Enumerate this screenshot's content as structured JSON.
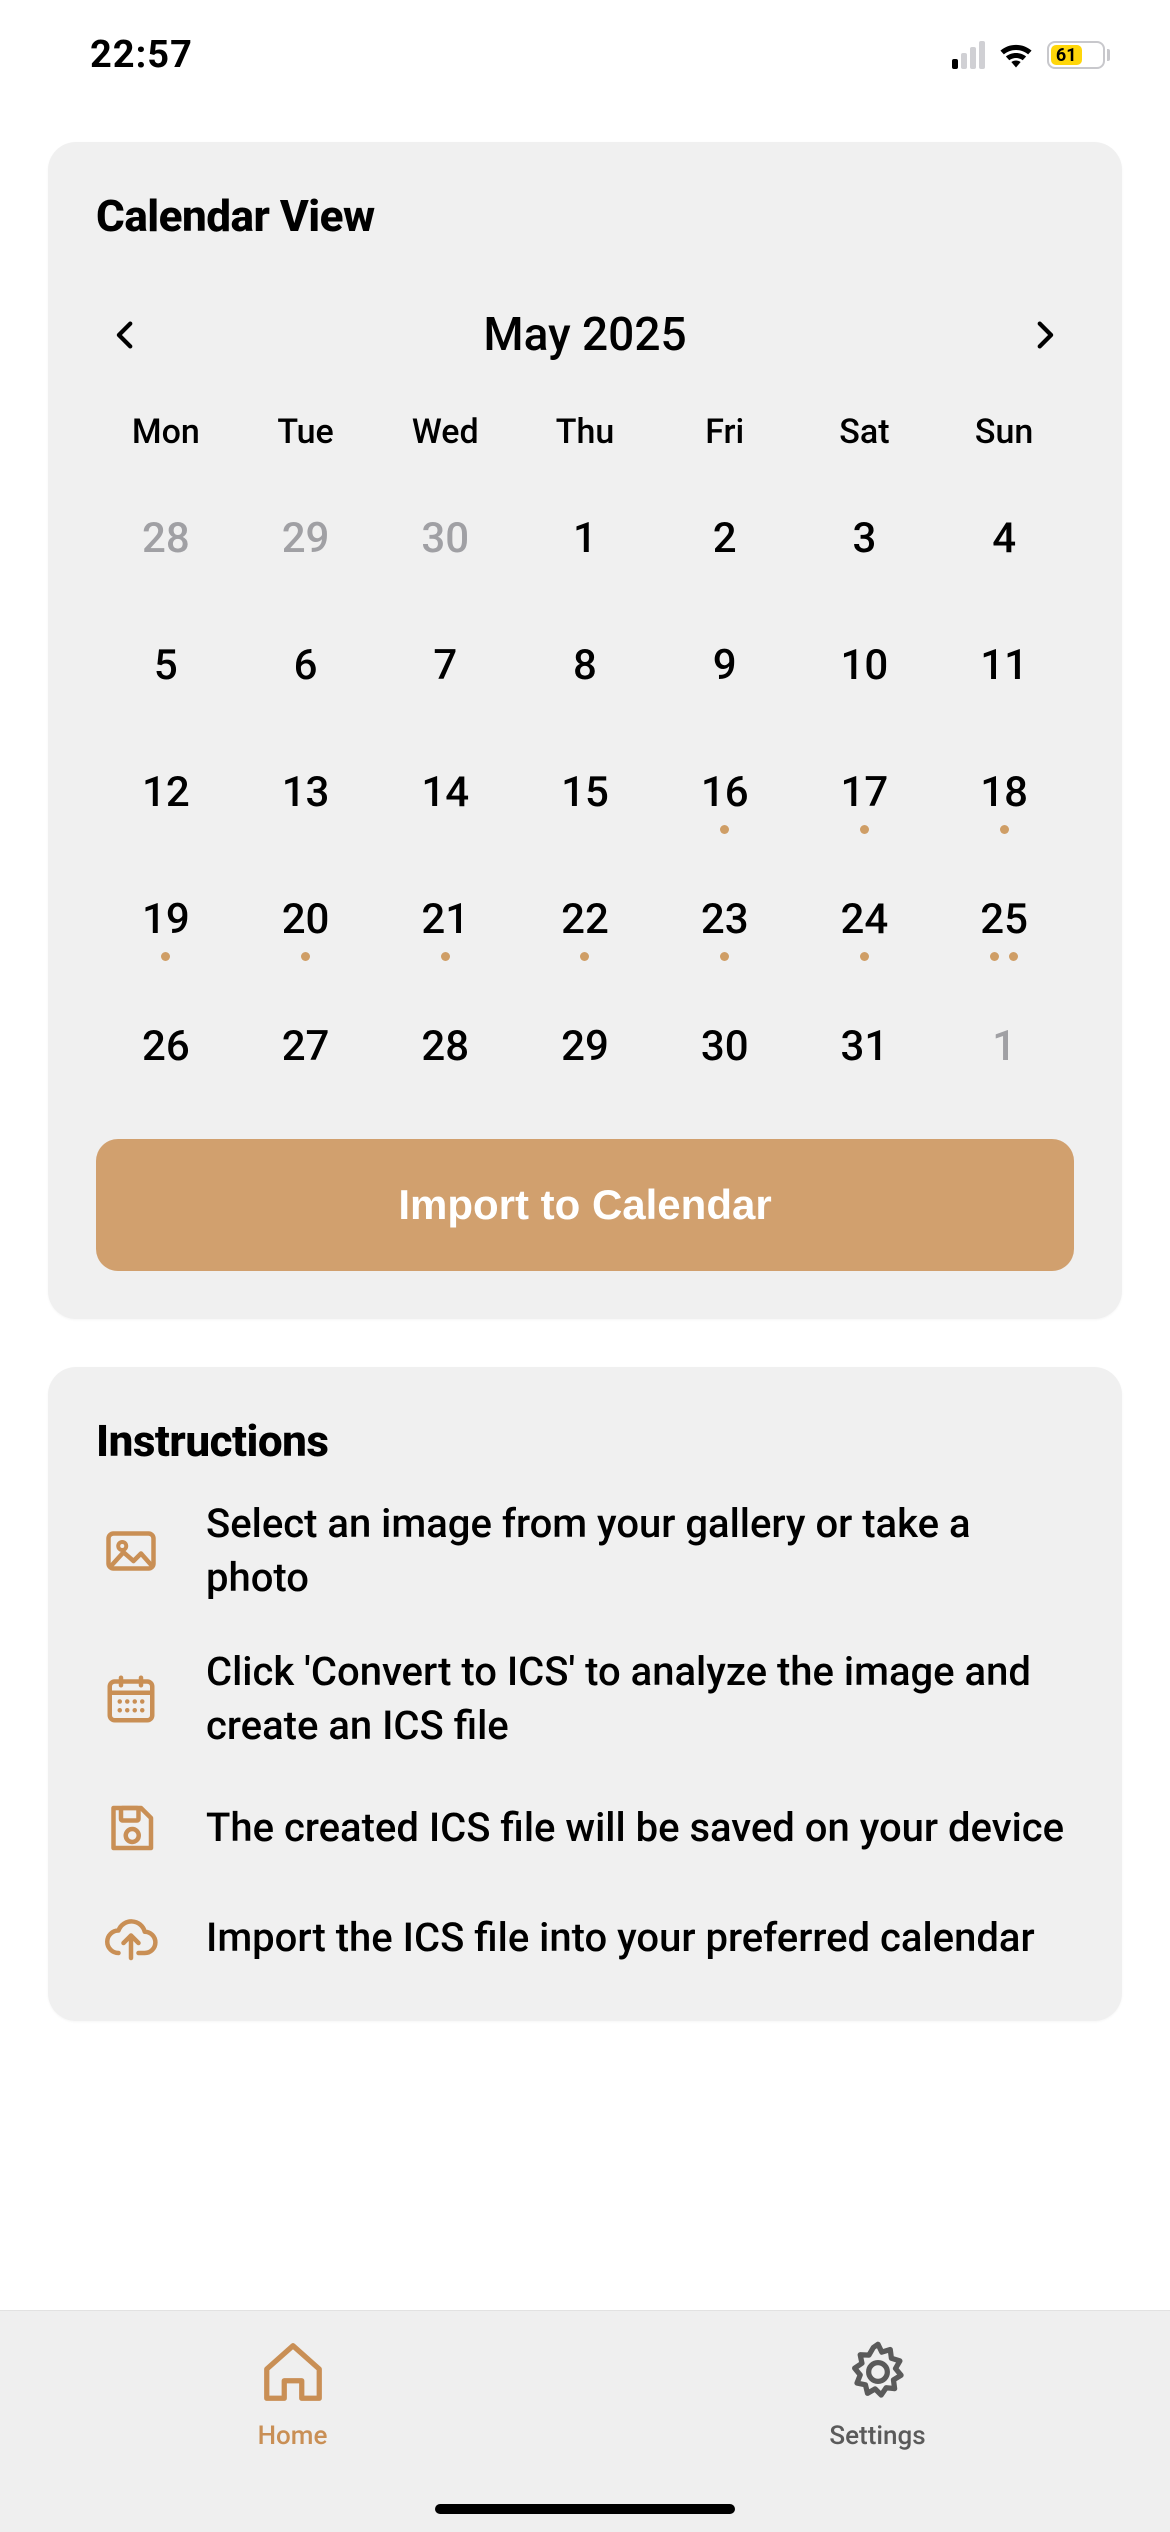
{
  "status": {
    "time": "22:57",
    "battery": "61"
  },
  "calendar_card": {
    "title": "Calendar View",
    "month_label": "May 2025",
    "weekdays": [
      "Mon",
      "Tue",
      "Wed",
      "Thu",
      "Fri",
      "Sat",
      "Sun"
    ],
    "days": [
      {
        "n": "28",
        "other": true,
        "dots": 0
      },
      {
        "n": "29",
        "other": true,
        "dots": 0
      },
      {
        "n": "30",
        "other": true,
        "dots": 0
      },
      {
        "n": "1",
        "other": false,
        "dots": 0
      },
      {
        "n": "2",
        "other": false,
        "dots": 0
      },
      {
        "n": "3",
        "other": false,
        "dots": 0
      },
      {
        "n": "4",
        "other": false,
        "dots": 0
      },
      {
        "n": "5",
        "other": false,
        "dots": 0
      },
      {
        "n": "6",
        "other": false,
        "dots": 0
      },
      {
        "n": "7",
        "other": false,
        "dots": 0
      },
      {
        "n": "8",
        "other": false,
        "dots": 0
      },
      {
        "n": "9",
        "other": false,
        "dots": 0
      },
      {
        "n": "10",
        "other": false,
        "dots": 0
      },
      {
        "n": "11",
        "other": false,
        "dots": 0
      },
      {
        "n": "12",
        "other": false,
        "dots": 0
      },
      {
        "n": "13",
        "other": false,
        "dots": 0
      },
      {
        "n": "14",
        "other": false,
        "dots": 0
      },
      {
        "n": "15",
        "other": false,
        "dots": 0
      },
      {
        "n": "16",
        "other": false,
        "dots": 1
      },
      {
        "n": "17",
        "other": false,
        "dots": 1
      },
      {
        "n": "18",
        "other": false,
        "dots": 1
      },
      {
        "n": "19",
        "other": false,
        "dots": 1
      },
      {
        "n": "20",
        "other": false,
        "dots": 1
      },
      {
        "n": "21",
        "other": false,
        "dots": 1
      },
      {
        "n": "22",
        "other": false,
        "dots": 1
      },
      {
        "n": "23",
        "other": false,
        "dots": 1
      },
      {
        "n": "24",
        "other": false,
        "dots": 1
      },
      {
        "n": "25",
        "other": false,
        "dots": 2
      },
      {
        "n": "26",
        "other": false,
        "dots": 0
      },
      {
        "n": "27",
        "other": false,
        "dots": 0
      },
      {
        "n": "28",
        "other": false,
        "dots": 0
      },
      {
        "n": "29",
        "other": false,
        "dots": 0
      },
      {
        "n": "30",
        "other": false,
        "dots": 0
      },
      {
        "n": "31",
        "other": false,
        "dots": 0
      },
      {
        "n": "1",
        "other": true,
        "dots": 0
      }
    ],
    "import_label": "Import to Calendar"
  },
  "instructions_card": {
    "title": "Instructions",
    "items": [
      {
        "icon": "image-icon",
        "text": "Select an image from your gallery or take a photo"
      },
      {
        "icon": "calendar-icon",
        "text": "Click 'Convert to ICS' to analyze the image and create an ICS file"
      },
      {
        "icon": "save-icon",
        "text": "The created ICS file will be saved on your device"
      },
      {
        "icon": "cloud-upload-icon",
        "text": "Import the ICS file into your preferred calendar"
      }
    ]
  },
  "tabs": {
    "home": "Home",
    "settings": "Settings"
  },
  "colors": {
    "accent": "#d1a06e",
    "card_bg": "#f0f0f0"
  }
}
